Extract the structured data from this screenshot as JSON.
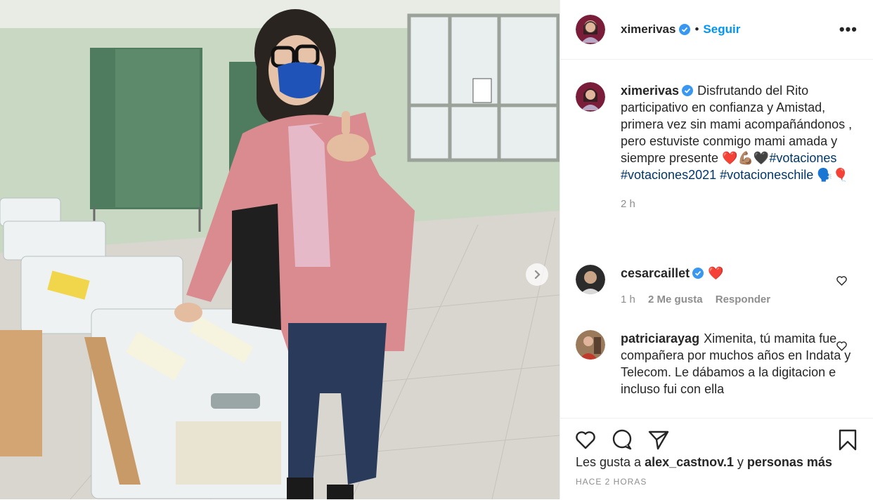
{
  "post": {
    "author": "ximerivas",
    "separator": "•",
    "follow_label": "Seguir",
    "more_label": "•••"
  },
  "caption": {
    "user": "ximerivas",
    "text": "Disfrutando del Rito participativo en confianza y Amistad, primera vez sin mami acompañándonos , pero estuviste conmigo mami amada y siempre presente ",
    "emojis": "❤️💪🏽🖤",
    "hashtags": [
      "#votaciones",
      "#votaciones2021",
      "#votacioneschile"
    ],
    "trailing_emojis": "🗣️🎈",
    "time": "2 h"
  },
  "comments": [
    {
      "user": "cesarcaillet",
      "text": "❤️",
      "time": "1 h",
      "likes": "2 Me gusta",
      "reply": "Responder"
    },
    {
      "user": "patriciarayag",
      "text": "Ximenita, tú mamita fue compañera por muchos años en Indata y Telecom. Le dábamos a la digitacion e incluso fui con ella",
      "time": "",
      "likes": "",
      "reply": ""
    }
  ],
  "likes": {
    "prefix": "Les gusta a",
    "user": "alex_castnov.1",
    "middle": "y",
    "suffix": "personas más"
  },
  "timestamp": "HACE 2 HORAS",
  "colors": {
    "link": "#0095f6",
    "hashtag": "#00376b",
    "muted": "#8e8e8e",
    "verified": "#3897f0"
  }
}
